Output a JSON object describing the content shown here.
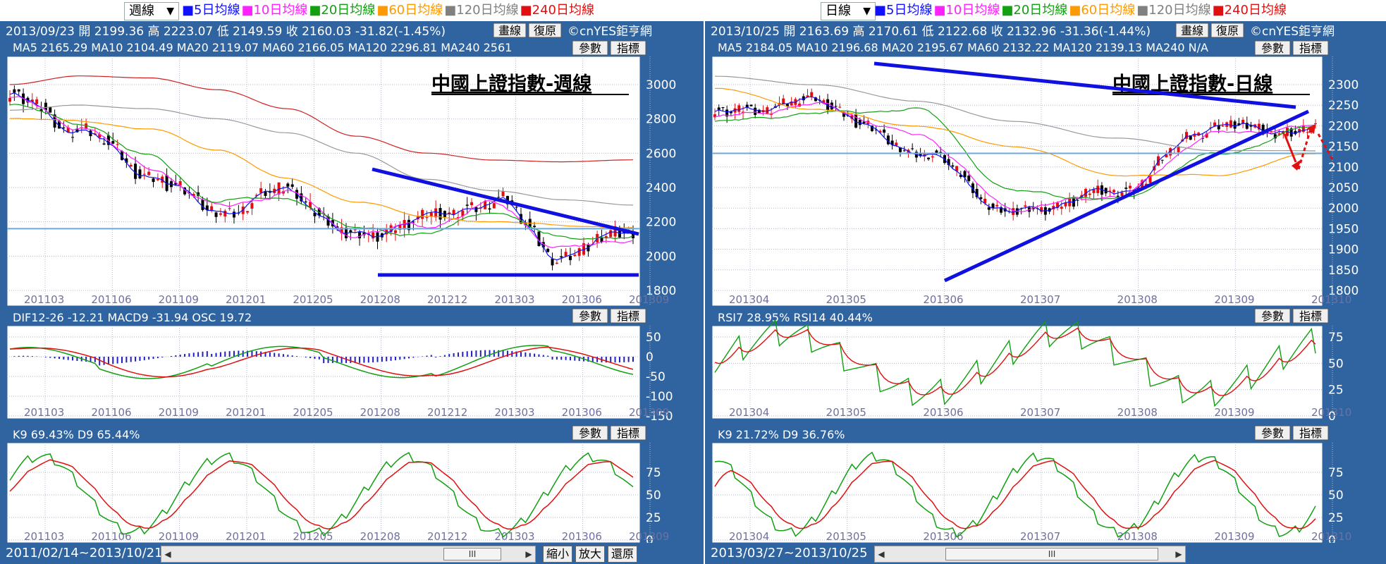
{
  "legend_items": [
    {
      "label": "■5日均線",
      "color": "#1010ff"
    },
    {
      "label": "■10日均線",
      "color": "#ff20ff"
    },
    {
      "label": "■20日均線",
      "color": "#10a010"
    },
    {
      "label": "■60日均線",
      "color": "#ff9900"
    },
    {
      "label": "■120日均線",
      "color": "#808080"
    },
    {
      "label": "■240日均線",
      "color": "#e01010"
    }
  ],
  "colors": {
    "frame": "#2f64a0",
    "ma5": "#1010ff",
    "ma10": "#ff20ff",
    "ma20": "#10a010",
    "ma60": "#ff9900",
    "ma120": "#999999",
    "ma240": "#d02020",
    "up_candle": "#e01010",
    "down_candle": "#000000",
    "trend": "#1010e0",
    "k_line": "#10a010",
    "d_line": "#e01010"
  },
  "buttons": {
    "draw": "畫線",
    "restore": "復原",
    "brand": "©cnYES鉅亨網",
    "params": "參數",
    "indicator": "指標",
    "zoom_out": "縮小",
    "zoom_in": "放大",
    "reset": "還原",
    "scroll_thumb": "III",
    "scroll_left": "◀",
    "scroll_right": "▶"
  },
  "left": {
    "period": "週線",
    "header_line1": "2013/09/23 開 2199.36 高 2223.07 低 2149.59 收 2160.03 -31.82(-1.45%)",
    "header_line2": "MA5 2165.29   MA10 2104.49   MA20 2119.07   MA60 2166.05   MA120 2296.81   MA240 2561",
    "title": "中國上證指數-週線",
    "range_text": "2011/02/14~2013/10/21",
    "macd_header": "DIF12-26 -12.21   MACD9 -31.94   OSC 19.72",
    "kd_header": "K9 69.43%   D9 65.44%",
    "price_ticks": [
      "3000",
      "2800",
      "2600",
      "2400",
      "2200",
      "2000",
      "1800"
    ],
    "macd_ticks": [
      "50",
      "0",
      "-50",
      "-100",
      "-150"
    ],
    "kd_ticks": [
      "75",
      "50",
      "25",
      "0"
    ],
    "x_labels": [
      "201103",
      "201106",
      "201109",
      "201201",
      "201205",
      "201208",
      "201212",
      "201303",
      "201306",
      "201309"
    ]
  },
  "right": {
    "period": "日線",
    "header_line1": "2013/10/25 開 2163.69 高 2170.61 低 2122.68 收 2132.96 -31.36(-1.44%)",
    "header_line2": "MA5 2184.05   MA10 2196.68   MA20 2195.67   MA60 2132.22   MA120 2139.13   MA240 N/A",
    "title": "中國上證指數-日線",
    "range_text": "2013/03/27~2013/10/25",
    "rsi_header": "RSI7 28.95%   RSI14 40.44%",
    "kd_header": "K9 21.72%   D9 36.76%",
    "price_ticks": [
      "2300",
      "2250",
      "2200",
      "2150",
      "2100",
      "2050",
      "2000",
      "1950",
      "1900",
      "1850",
      "1800"
    ],
    "rsi_ticks": [
      "75",
      "50",
      "25",
      "0"
    ],
    "kd_ticks": [
      "75",
      "50",
      "25",
      "0"
    ],
    "x_labels": [
      "201304",
      "201305",
      "201306",
      "201307",
      "201308",
      "201309",
      "201310"
    ]
  },
  "chart_data": [
    {
      "type": "line",
      "title": "中國上證指數-週線",
      "ylim": [
        1800,
        3100
      ],
      "x": [
        "201103",
        "201106",
        "201109",
        "201201",
        "201205",
        "201208",
        "201212",
        "201303",
        "201306",
        "201309"
      ],
      "series": [
        {
          "name": "MA5",
          "values": [
            2930,
            2740,
            2480,
            2260,
            2380,
            2110,
            2220,
            2320,
            2000,
            2165
          ]
        },
        {
          "name": "MA10",
          "values": [
            2920,
            2760,
            2520,
            2290,
            2370,
            2130,
            2180,
            2300,
            2040,
            2104
          ]
        },
        {
          "name": "MA20",
          "values": [
            2880,
            2780,
            2580,
            2320,
            2340,
            2160,
            2130,
            2260,
            2100,
            2119
          ]
        },
        {
          "name": "MA60",
          "values": [
            2800,
            2790,
            2740,
            2620,
            2450,
            2320,
            2230,
            2200,
            2180,
            2166
          ]
        },
        {
          "name": "MA120",
          "values": [
            2850,
            2880,
            2860,
            2800,
            2720,
            2600,
            2450,
            2380,
            2330,
            2297
          ]
        },
        {
          "name": "MA240",
          "values": [
            3000,
            3050,
            3040,
            2970,
            2860,
            2700,
            2600,
            2560,
            2550,
            2561
          ]
        }
      ]
    },
    {
      "type": "line",
      "title": "中國上證指數-日線",
      "ylim": [
        1800,
        2350
      ],
      "x": [
        "201304",
        "201305",
        "201306",
        "201307",
        "201308",
        "201309",
        "201310"
      ],
      "series": [
        {
          "name": "MA5",
          "values": [
            2230,
            2260,
            2140,
            1990,
            2040,
            2200,
            2184
          ]
        },
        {
          "name": "MA10",
          "values": [
            2220,
            2250,
            2180,
            2000,
            2030,
            2180,
            2197
          ]
        },
        {
          "name": "MA20",
          "values": [
            2210,
            2230,
            2240,
            2040,
            2020,
            2130,
            2196
          ]
        },
        {
          "name": "MA60",
          "values": [
            2290,
            2240,
            2200,
            2150,
            2080,
            2080,
            2132
          ]
        },
        {
          "name": "MA120",
          "values": [
            2320,
            2300,
            2260,
            2210,
            2170,
            2140,
            2139
          ]
        }
      ]
    }
  ]
}
